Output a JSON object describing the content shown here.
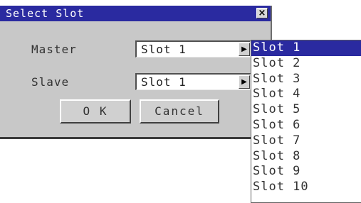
{
  "dialog": {
    "title": "Select Slot",
    "close_glyph": "×",
    "master_label": "Master",
    "slave_label": "Slave",
    "master_value": "Slot 1",
    "slave_value": "Slot 1",
    "ok_label": "O K",
    "cancel_label": "Cancel",
    "dropdown_glyph": "▶"
  },
  "dropdown": {
    "selected": "Slot 1",
    "items": [
      "Slot 1",
      "Slot 2",
      "Slot 3",
      "Slot 4",
      "Slot 5",
      "Slot 6",
      "Slot 7",
      "Slot 8",
      "Slot 9",
      "Slot 10"
    ]
  },
  "colors": {
    "title_bar": "#2a2aa0",
    "dialog_bg": "#c8c8c8",
    "selection": "#2a2aa0"
  }
}
